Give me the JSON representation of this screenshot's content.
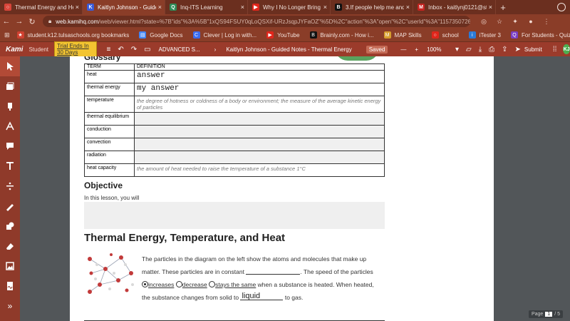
{
  "tabs": [
    {
      "title": "Thermal Energy and He...",
      "color": "#d9453a",
      "glyph": "○",
      "active": false
    },
    {
      "title": "Kaitlyn Johnson - Guided...",
      "color": "#3a5bd9",
      "glyph": "K",
      "active": true
    },
    {
      "title": "Inq-ITS Learning",
      "color": "#2e8b57",
      "glyph": "Q",
      "active": false
    },
    {
      "title": "Why I No Longer Bring M...",
      "color": "#e0261b",
      "glyph": "▶",
      "active": false
    },
    {
      "title": "3.If people help me and...",
      "color": "#111111",
      "glyph": "B",
      "active": false
    },
    {
      "title": "Inbox - kaitlynj0121@st...",
      "color": "#c5221f",
      "glyph": "M",
      "active": false
    }
  ],
  "new_tab_label": "+",
  "url": {
    "host": "web.kamihq.com",
    "rest": "/web/viewer.html?state=%7B\"ids\"%3A%5B\"1xQS94FSUY0qLoQSXif-URzJsqpJYFaOZ\"%5D%2C\"action\"%3A\"open\"%2C\"userId\"%3A\"11573507263..."
  },
  "bookmarks": [
    {
      "label": "student.k12.tulsaschools.org bookmarks",
      "color": "#d04030",
      "glyph": "★"
    },
    {
      "label": "Google Docs",
      "color": "#4285f4",
      "glyph": "▤"
    },
    {
      "label": "Clever | Log in with...",
      "color": "#3a6cf0",
      "glyph": "C"
    },
    {
      "label": "YouTube",
      "color": "#e0261b",
      "glyph": "▶"
    },
    {
      "label": "Brainly.com - How i...",
      "color": "#111111",
      "glyph": "B"
    },
    {
      "label": "MAP Skills",
      "color": "#d69e2e",
      "glyph": "M"
    },
    {
      "label": "school",
      "color": "#e0261b",
      "glyph": "○"
    },
    {
      "label": "iTester 3",
      "color": "#2b7bd9",
      "glyph": "i"
    },
    {
      "label": "For Students - Quizi...",
      "color": "#7a3fc4",
      "glyph": "Q"
    }
  ],
  "kami": {
    "logo": "Kami",
    "role": "Student",
    "trial": "Trial Ends In 30 Days",
    "breadcrumb_folder": "ADVANCED S...",
    "doc_title": "Kaitlyn Johnson - Guided Notes - Thermal Energy",
    "status": "Saved",
    "zoom_minus": "—",
    "zoom_value": "100%",
    "zoom_plus": "+",
    "submit": "Submit",
    "avatar": "KJ"
  },
  "document": {
    "glossary_title": "Glossary",
    "table_headers": [
      "TERM",
      "DEFINITION"
    ],
    "rows": [
      {
        "term": "heat",
        "definition": "answer",
        "kind": "answer"
      },
      {
        "term": "thermal energy",
        "definition": "my answer",
        "kind": "answer"
      },
      {
        "term": "temperature",
        "definition": "the degree of hotness or coldness of a body or environment; the measure of the average kinetic energy of particles",
        "kind": "italic"
      },
      {
        "term": "thermal equilibrium",
        "definition": "",
        "kind": "empty"
      },
      {
        "term": "conduction",
        "definition": "",
        "kind": "empty"
      },
      {
        "term": "convection",
        "definition": "",
        "kind": "empty"
      },
      {
        "term": "radiation",
        "definition": "",
        "kind": "empty"
      },
      {
        "term": "heat capacity",
        "definition": "the amount of heat needed to raise the temperature of a substance 1°C",
        "kind": "italic"
      }
    ],
    "objective_title": "Objective",
    "objective_text": "In this lesson, you will",
    "section_title": "Thermal Energy, Temperature, and Heat",
    "para": {
      "line1": "The particles in the diagram on the left show the atoms and molecules that make up",
      "line2a": "matter. These particles are in constant",
      "line2b": ". The speed of the particles",
      "opt1": "increases",
      "opt2": "decrease",
      "opt3": "stays the same",
      "line3b": "when a substance is heated. When heated,",
      "line4a": "the substance changes from solid to",
      "blank_answer": "liquid",
      "line4b": "to gas."
    }
  },
  "page_indicator": {
    "label": "Page",
    "current": "1",
    "total": "/ 5"
  }
}
